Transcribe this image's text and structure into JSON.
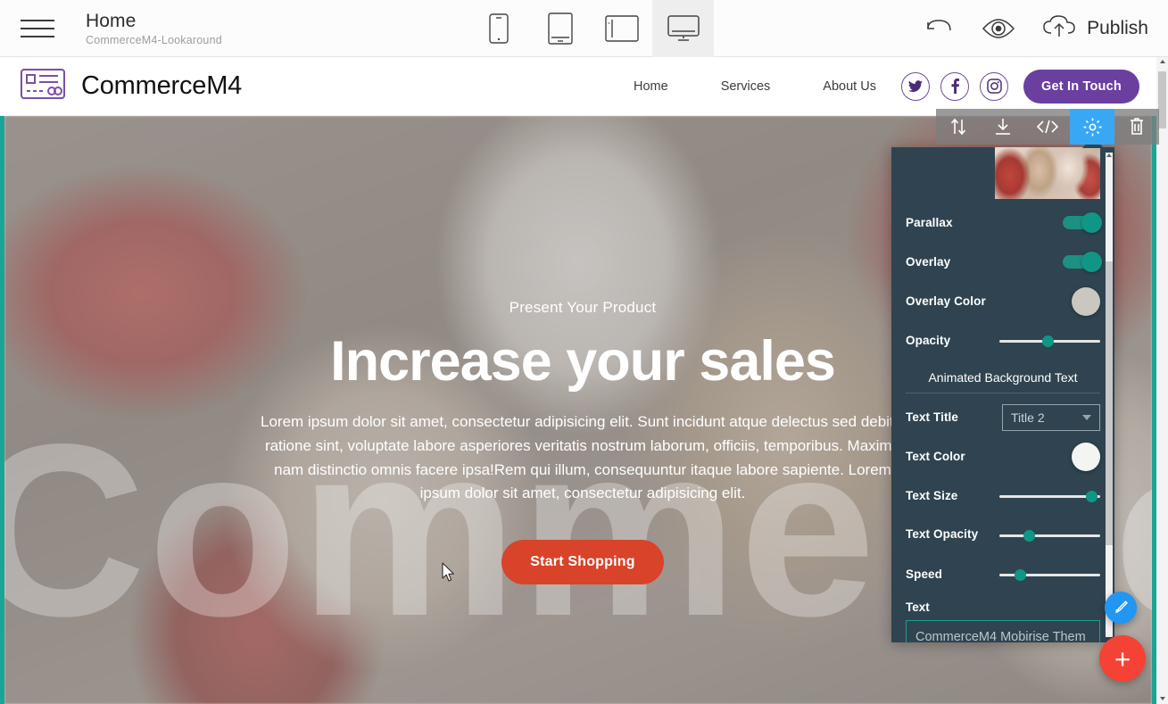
{
  "editor": {
    "menu_icon": "hamburger-icon",
    "page_title": "Home",
    "page_subtitle": "CommerceM4-Lookaround",
    "devices": [
      {
        "name": "mobile",
        "label": "Mobile",
        "active": false
      },
      {
        "name": "tablet-portrait",
        "label": "Tablet Portrait",
        "active": false
      },
      {
        "name": "tablet-landscape",
        "label": "Tablet Landscape",
        "active": false
      },
      {
        "name": "desktop",
        "label": "Desktop",
        "active": true
      }
    ],
    "undo_icon": "undo-icon",
    "preview_icon": "eye-icon",
    "publish_icon": "cloud-upload-icon",
    "publish_label": "Publish"
  },
  "site": {
    "logo_icon": "card-logo-icon",
    "brand": "CommerceM4",
    "nav": [
      {
        "label": "Home"
      },
      {
        "label": "Services"
      },
      {
        "label": "About Us"
      }
    ],
    "socials": [
      {
        "name": "twitter-icon",
        "glyph": "twitter"
      },
      {
        "name": "facebook-icon",
        "glyph": "facebook"
      },
      {
        "name": "instagram-icon",
        "glyph": "instagram"
      }
    ],
    "cta_label": "Get In Touch",
    "brand_color": "#6b3fa0"
  },
  "hero": {
    "kicker": "Present Your Product",
    "title": "Increase your sales",
    "paragraph": "Lorem ipsum dolor sit amet, consectetur adipisicing elit. Sunt incidunt atque delectus sed debitis ratione sint, voluptate labore asperiores veritatis nostrum laborum, officiis, temporibus. Maxime nam distinctio omnis facere ipsa!Rem qui illum, consequuntur itaque labore sapiente. Lorem ipsum dolor sit amet, consectetur adipisicing elit.",
    "button_label": "Start Shopping",
    "button_color": "#d8432a",
    "watermark_text": "CommerceM4 Mobirise Them",
    "selection_color": "#19a596"
  },
  "block_toolbar": {
    "buttons": [
      {
        "name": "move-block-icon",
        "label": "Move",
        "active": false
      },
      {
        "name": "download-icon",
        "label": "Download",
        "active": false
      },
      {
        "name": "code-icon",
        "label": "Code",
        "active": false
      },
      {
        "name": "gear-icon",
        "label": "Settings",
        "active": true
      },
      {
        "name": "trash-icon",
        "label": "Delete",
        "active": false
      }
    ],
    "active_color": "#38a8f5"
  },
  "panel": {
    "thumbnail_alt": "background image thumbnail",
    "parallax": {
      "label": "Parallax",
      "value": "on"
    },
    "overlay": {
      "label": "Overlay",
      "value": "on"
    },
    "overlay_color": {
      "label": "Overlay Color",
      "value": "#c9c7c0"
    },
    "opacity": {
      "label": "Opacity",
      "value": 48
    },
    "section_title": "Animated Background Text",
    "text_title": {
      "label": "Text Title",
      "value": "Title 2"
    },
    "text_color": {
      "label": "Text Color",
      "value": "#f4f4f2"
    },
    "text_size": {
      "label": "Text Size",
      "value": 97
    },
    "text_opacity": {
      "label": "Text Opacity",
      "value": 27
    },
    "speed": {
      "label": "Speed",
      "value": 17
    },
    "text": {
      "label": "Text",
      "value": "CommerceM4 Mobirise Them"
    },
    "background_color": "#2f4450",
    "accent_color": "#109686"
  },
  "fabs": {
    "pen": {
      "name": "pen-icon",
      "color": "#2196f3"
    },
    "add": {
      "name": "plus-icon",
      "label": "+",
      "color": "#f44336"
    }
  }
}
